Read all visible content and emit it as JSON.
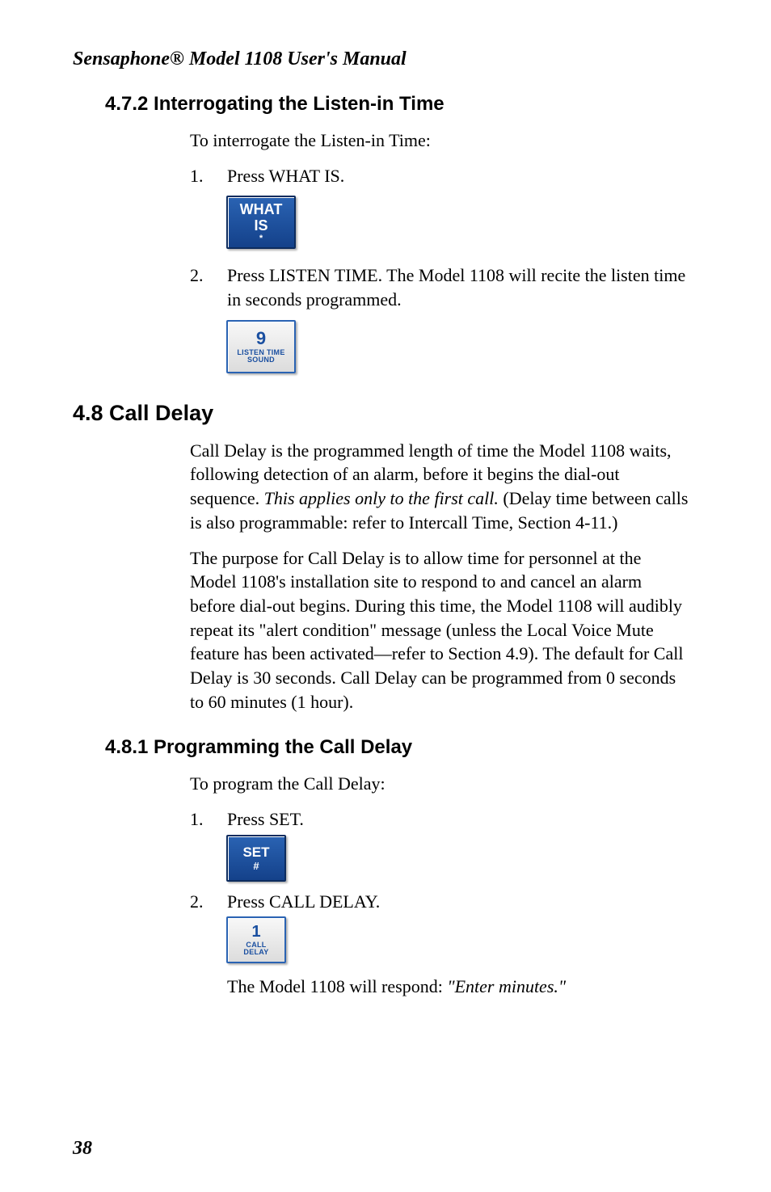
{
  "running_header": "Sensaphone® Model 1108 User's Manual",
  "sec_472": {
    "heading": "4.7.2  Interrogating the Listen-in Time",
    "intro": "To interrogate the Listen-in Time:",
    "step1_num": "1.",
    "step1_text": "Press WHAT IS.",
    "key_whatis_l1": "WHAT",
    "key_whatis_l2": "IS",
    "key_whatis_sym": "*",
    "step2_num": "2.",
    "step2_text": "Press LISTEN TIME. The Model 1108 will recite the listen time in seconds programmed.",
    "key_9_num": "9",
    "key_9_l1": "LISTEN TIME",
    "key_9_l2": "SOUND"
  },
  "sec_48": {
    "heading": "4.8  Call Delay",
    "para1_a": "Call Delay is the programmed length of time the Model 1108 waits, following detection of an alarm, before it begins the dial-out sequence. ",
    "para1_italic": "This applies only to the first call.",
    "para1_b": " (Delay time between calls is also programmable: refer to Intercall Time, Section 4-11.)",
    "para2": "The purpose for Call Delay is to allow time for personnel at the Model 1108's installation site to respond to and cancel an alarm before dial-out begins. During this time, the Model 1108 will audibly repeat its \"alert condition\" message (unless the Local Voice Mute feature has been activated—refer to Section 4.9). The default for Call Delay is 30 seconds. Call Delay can be programmed from 0 seconds to 60 minutes (1 hour)."
  },
  "sec_481": {
    "heading": "4.8.1  Programming the Call Delay",
    "intro": "To program the Call Delay:",
    "step1_num": "1.",
    "step1_text": "Press SET.",
    "key_set_l1": "SET",
    "key_set_sym": "#",
    "step2_num": "2.",
    "step2_text": "Press CALL DELAY.",
    "key_1_num": "1",
    "key_1_l1": "CALL",
    "key_1_l2": "DELAY",
    "response_a": "The Model 1108 will respond: ",
    "response_italic": "\"Enter minutes.\""
  },
  "page_number": "38"
}
